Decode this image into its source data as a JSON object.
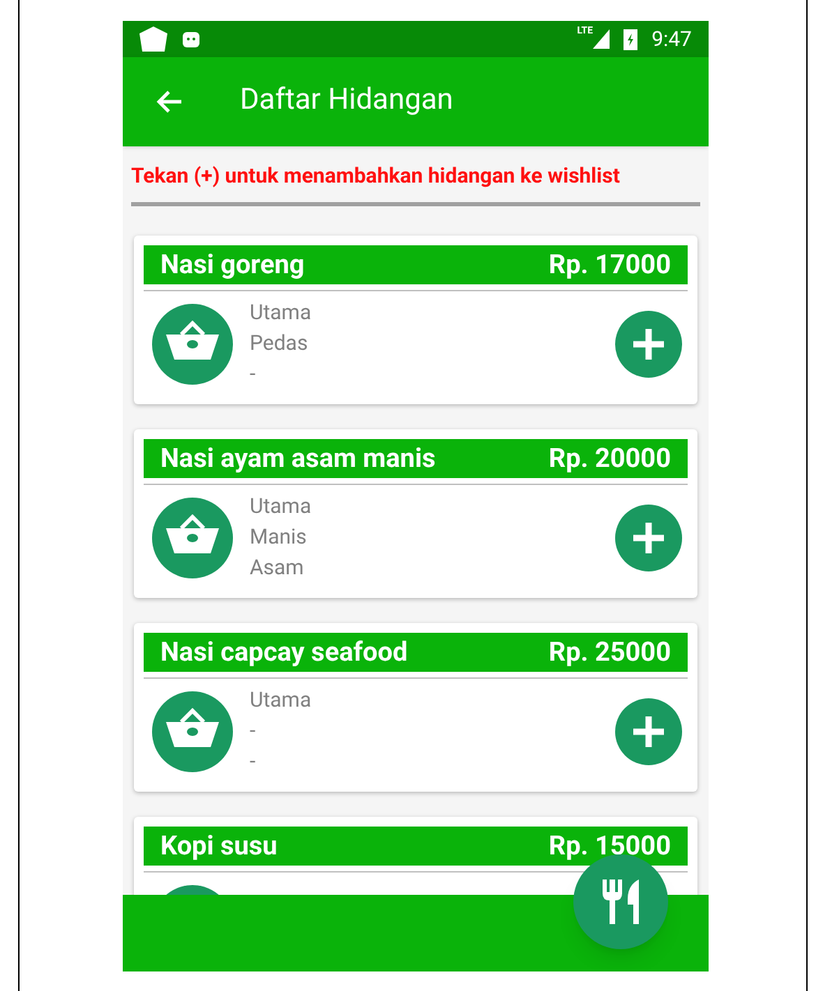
{
  "status_bar": {
    "network": "LTE",
    "time": "9:47"
  },
  "app_bar": {
    "title": "Daftar Hidangan"
  },
  "hint": "Tekan (+) untuk menambahkan hidangan ke wishlist",
  "dishes": [
    {
      "name": "Nasi goreng",
      "price": "Rp. 17000",
      "details": [
        "Utama",
        "Pedas",
        "-"
      ]
    },
    {
      "name": "Nasi ayam asam manis",
      "price": "Rp. 20000",
      "details": [
        "Utama",
        "Manis",
        "Asam"
      ]
    },
    {
      "name": "Nasi capcay seafood",
      "price": "Rp. 25000",
      "details": [
        "Utama",
        "-",
        "-"
      ]
    },
    {
      "name": "Kopi susu",
      "price": "Rp. 15000"
    }
  ]
}
